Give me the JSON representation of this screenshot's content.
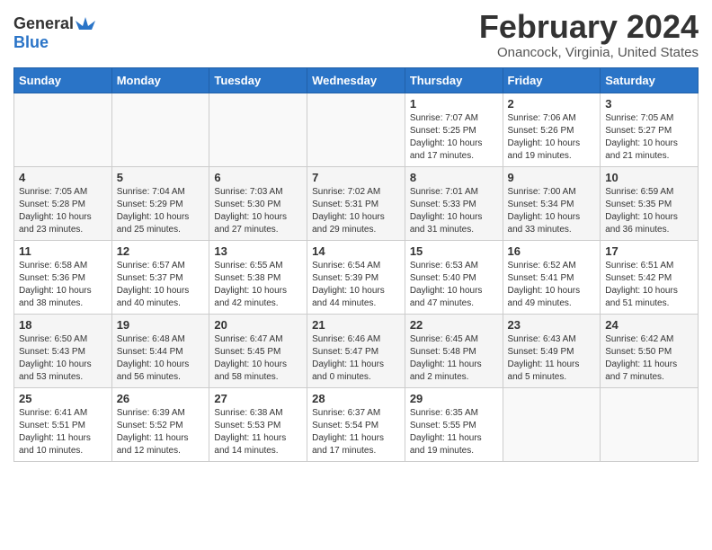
{
  "header": {
    "logo_general": "General",
    "logo_blue": "Blue",
    "month_title": "February 2024",
    "location": "Onancock, Virginia, United States"
  },
  "days_of_week": [
    "Sunday",
    "Monday",
    "Tuesday",
    "Wednesday",
    "Thursday",
    "Friday",
    "Saturday"
  ],
  "weeks": [
    [
      {
        "day": "",
        "info": ""
      },
      {
        "day": "",
        "info": ""
      },
      {
        "day": "",
        "info": ""
      },
      {
        "day": "",
        "info": ""
      },
      {
        "day": "1",
        "info": "Sunrise: 7:07 AM\nSunset: 5:25 PM\nDaylight: 10 hours\nand 17 minutes."
      },
      {
        "day": "2",
        "info": "Sunrise: 7:06 AM\nSunset: 5:26 PM\nDaylight: 10 hours\nand 19 minutes."
      },
      {
        "day": "3",
        "info": "Sunrise: 7:05 AM\nSunset: 5:27 PM\nDaylight: 10 hours\nand 21 minutes."
      }
    ],
    [
      {
        "day": "4",
        "info": "Sunrise: 7:05 AM\nSunset: 5:28 PM\nDaylight: 10 hours\nand 23 minutes."
      },
      {
        "day": "5",
        "info": "Sunrise: 7:04 AM\nSunset: 5:29 PM\nDaylight: 10 hours\nand 25 minutes."
      },
      {
        "day": "6",
        "info": "Sunrise: 7:03 AM\nSunset: 5:30 PM\nDaylight: 10 hours\nand 27 minutes."
      },
      {
        "day": "7",
        "info": "Sunrise: 7:02 AM\nSunset: 5:31 PM\nDaylight: 10 hours\nand 29 minutes."
      },
      {
        "day": "8",
        "info": "Sunrise: 7:01 AM\nSunset: 5:33 PM\nDaylight: 10 hours\nand 31 minutes."
      },
      {
        "day": "9",
        "info": "Sunrise: 7:00 AM\nSunset: 5:34 PM\nDaylight: 10 hours\nand 33 minutes."
      },
      {
        "day": "10",
        "info": "Sunrise: 6:59 AM\nSunset: 5:35 PM\nDaylight: 10 hours\nand 36 minutes."
      }
    ],
    [
      {
        "day": "11",
        "info": "Sunrise: 6:58 AM\nSunset: 5:36 PM\nDaylight: 10 hours\nand 38 minutes."
      },
      {
        "day": "12",
        "info": "Sunrise: 6:57 AM\nSunset: 5:37 PM\nDaylight: 10 hours\nand 40 minutes."
      },
      {
        "day": "13",
        "info": "Sunrise: 6:55 AM\nSunset: 5:38 PM\nDaylight: 10 hours\nand 42 minutes."
      },
      {
        "day": "14",
        "info": "Sunrise: 6:54 AM\nSunset: 5:39 PM\nDaylight: 10 hours\nand 44 minutes."
      },
      {
        "day": "15",
        "info": "Sunrise: 6:53 AM\nSunset: 5:40 PM\nDaylight: 10 hours\nand 47 minutes."
      },
      {
        "day": "16",
        "info": "Sunrise: 6:52 AM\nSunset: 5:41 PM\nDaylight: 10 hours\nand 49 minutes."
      },
      {
        "day": "17",
        "info": "Sunrise: 6:51 AM\nSunset: 5:42 PM\nDaylight: 10 hours\nand 51 minutes."
      }
    ],
    [
      {
        "day": "18",
        "info": "Sunrise: 6:50 AM\nSunset: 5:43 PM\nDaylight: 10 hours\nand 53 minutes."
      },
      {
        "day": "19",
        "info": "Sunrise: 6:48 AM\nSunset: 5:44 PM\nDaylight: 10 hours\nand 56 minutes."
      },
      {
        "day": "20",
        "info": "Sunrise: 6:47 AM\nSunset: 5:45 PM\nDaylight: 10 hours\nand 58 minutes."
      },
      {
        "day": "21",
        "info": "Sunrise: 6:46 AM\nSunset: 5:47 PM\nDaylight: 11 hours\nand 0 minutes."
      },
      {
        "day": "22",
        "info": "Sunrise: 6:45 AM\nSunset: 5:48 PM\nDaylight: 11 hours\nand 2 minutes."
      },
      {
        "day": "23",
        "info": "Sunrise: 6:43 AM\nSunset: 5:49 PM\nDaylight: 11 hours\nand 5 minutes."
      },
      {
        "day": "24",
        "info": "Sunrise: 6:42 AM\nSunset: 5:50 PM\nDaylight: 11 hours\nand 7 minutes."
      }
    ],
    [
      {
        "day": "25",
        "info": "Sunrise: 6:41 AM\nSunset: 5:51 PM\nDaylight: 11 hours\nand 10 minutes."
      },
      {
        "day": "26",
        "info": "Sunrise: 6:39 AM\nSunset: 5:52 PM\nDaylight: 11 hours\nand 12 minutes."
      },
      {
        "day": "27",
        "info": "Sunrise: 6:38 AM\nSunset: 5:53 PM\nDaylight: 11 hours\nand 14 minutes."
      },
      {
        "day": "28",
        "info": "Sunrise: 6:37 AM\nSunset: 5:54 PM\nDaylight: 11 hours\nand 17 minutes."
      },
      {
        "day": "29",
        "info": "Sunrise: 6:35 AM\nSunset: 5:55 PM\nDaylight: 11 hours\nand 19 minutes."
      },
      {
        "day": "",
        "info": ""
      },
      {
        "day": "",
        "info": ""
      }
    ]
  ]
}
